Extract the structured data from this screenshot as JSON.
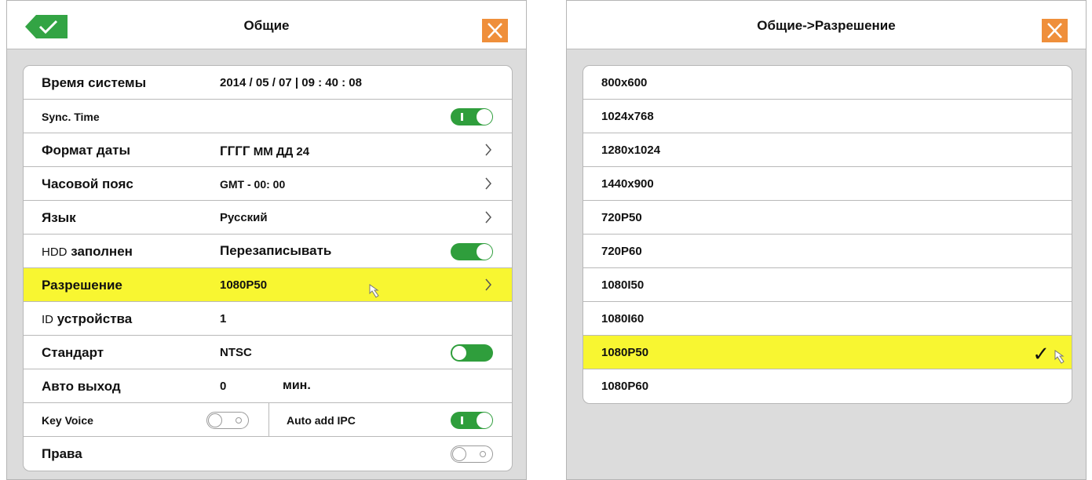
{
  "left": {
    "title": "Общие",
    "rows": {
      "system_time": {
        "label": "Время системы",
        "value": "2014 / 05 / 07 | 09 : 40 : 08"
      },
      "sync_time": {
        "label": "Sync. Time"
      },
      "date_format": {
        "label": "Формат даты",
        "value_main": "ГГГГ",
        "value_rest": "ММ ДД 24"
      },
      "timezone": {
        "label": "Часовой пояс",
        "value": "GMT - 00: 00"
      },
      "language": {
        "label": "Язык",
        "value": "Русский"
      },
      "hdd_full": {
        "label_prefix": "HDD",
        "label_rest": " заполнен",
        "value": "Перезаписывать"
      },
      "resolution": {
        "label": "Разрешение",
        "value": "1080P50"
      },
      "device_id": {
        "label_prefix": "ID",
        "label_rest": " устройства",
        "value": "1"
      },
      "standard": {
        "label": "Стандарт",
        "value": "NTSC"
      },
      "auto_exit": {
        "label": "Авто выход",
        "value": "0",
        "unit": "мин."
      },
      "key_voice": {
        "label": "Key Voice",
        "auto_add_label": "Auto add IPC"
      },
      "rights": {
        "label": "Права"
      }
    }
  },
  "right": {
    "title": "Общие->Разрешение",
    "options": [
      "800x600",
      "1024x768",
      "1280x1024",
      "1440x900",
      "720P50",
      "720P60",
      "1080I50",
      "1080I60",
      "1080P50",
      "1080P60"
    ],
    "selected": "1080P50",
    "check_mark": "✓"
  },
  "colors": {
    "highlight": "#f8f631",
    "toggle_green": "#2f9e3c",
    "close_orange": "#ef8f3b",
    "ok_green": "#33a444"
  }
}
